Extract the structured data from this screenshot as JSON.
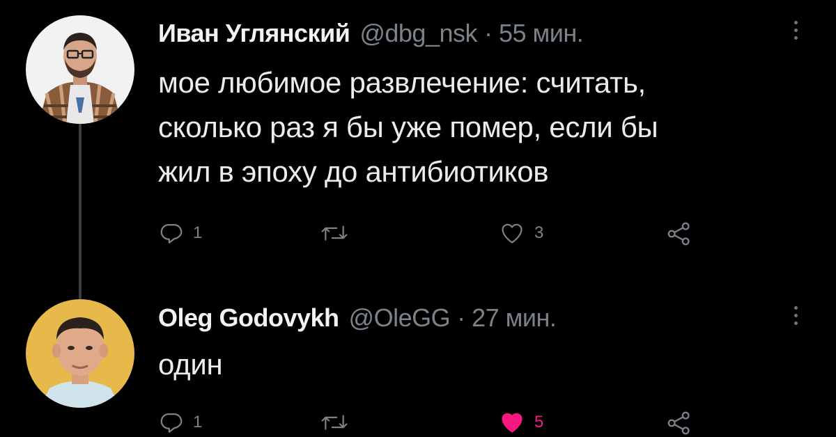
{
  "tweets": [
    {
      "author_name": "Иван Углянский",
      "handle": "@dbg_nsk",
      "time": "· 55 мин.",
      "text_lines": [
        "мое любимое развлечение: считать,",
        "сколько раз я бы уже помер, если бы",
        "жил в эпоху до антибиотиков"
      ],
      "reply_count": "1",
      "like_count": "3",
      "liked": false
    },
    {
      "author_name": "Oleg Godovykh",
      "handle": "@OleGG",
      "time": "· 27 мин.",
      "text_lines": [
        "один"
      ],
      "reply_count": "1",
      "like_count": "5",
      "liked": true
    }
  ],
  "colors": {
    "background": "#000000",
    "text": "#e7e9ea",
    "muted": "#7c8289",
    "like_active": "#f91880",
    "thread_line": "#3a3d40"
  },
  "icons": [
    "reply-icon",
    "retweet-icon",
    "like-icon",
    "share-icon",
    "more-options-icon"
  ]
}
